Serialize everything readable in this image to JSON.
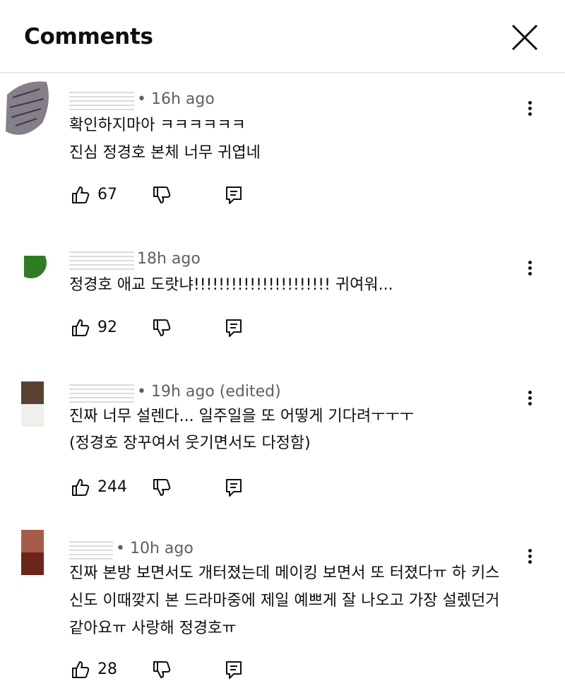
{
  "header": {
    "title": "Comments"
  },
  "comments": [
    {
      "time": "• 16h ago",
      "lines": [
        "확인하지마아 ㅋㅋㅋㅋㅋㅋ",
        "진심 정경호 본체 너무 귀엽네"
      ],
      "likes": "67"
    },
    {
      "time": "18h ago",
      "lines": [
        "정경호 애교 도랏냐!!!!!!!!!!!!!!!!!!!!!! 귀여워..."
      ],
      "likes": "92"
    },
    {
      "time": "• 19h ago (edited)",
      "lines": [
        "진짜 너무 설렌다... 일주일을 또 어떻게 기다려ㅜㅜㅜ",
        "(정경호 장꾸여서 웃기면서도 다정함)"
      ],
      "likes": "244"
    },
    {
      "time": "• 10h ago",
      "lines": [
        "진짜 본방 보면서도 개터졌는데 메이킹 보면서 또 터졌다ㅠ 하 키스",
        "신도 이때깢지 본 드라마중에 제일 예쁘게 잘 나오고 가장 설렜던거",
        "같아요ㅠ 사랑해 정경호ㅠ"
      ],
      "likes": "28"
    }
  ],
  "icons": {
    "close": "close-icon",
    "like": "thumb-up-icon",
    "dislike": "thumb-down-icon",
    "reply": "reply-icon",
    "more": "more-vert-icon"
  }
}
